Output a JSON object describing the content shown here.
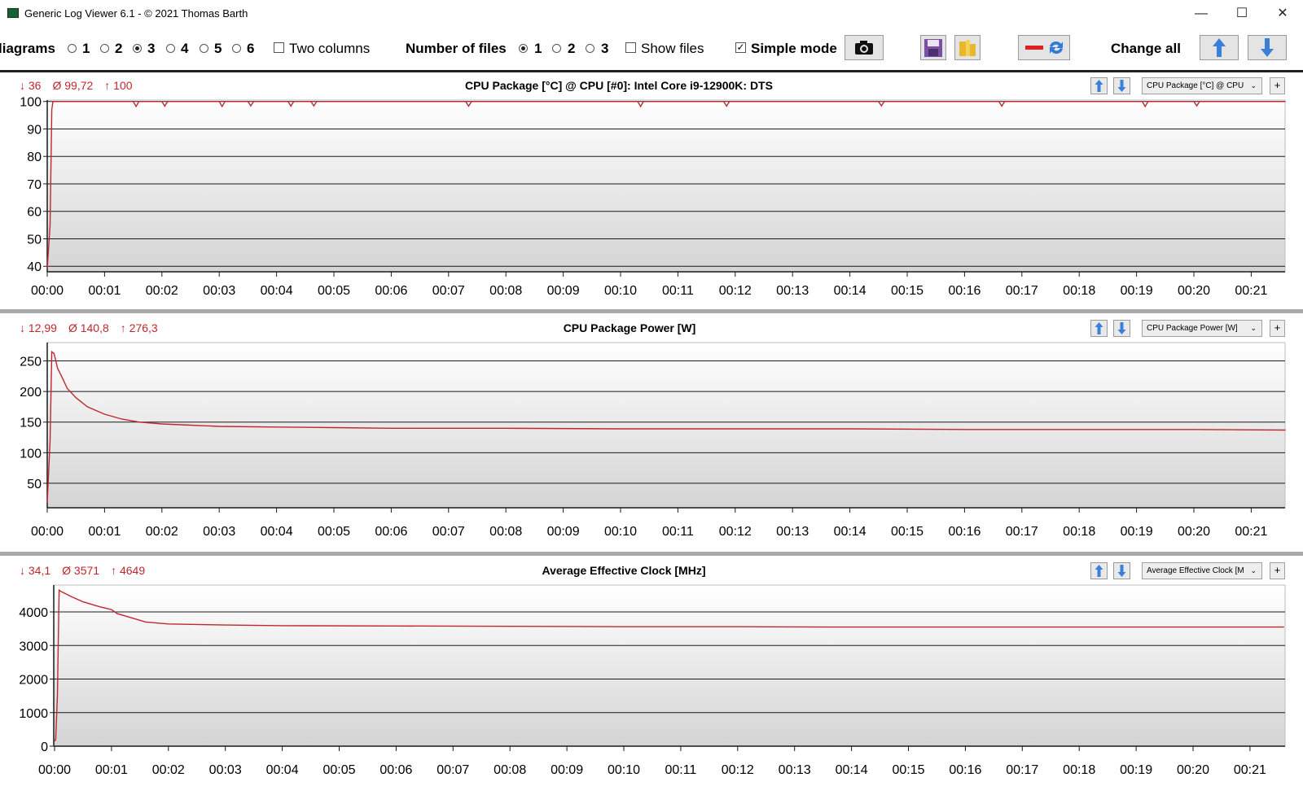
{
  "window": {
    "title": "Generic Log Viewer 6.1 - © 2021 Thomas Barth",
    "minimize": "—",
    "maximize": "☐",
    "close": "✕"
  },
  "toolbar": {
    "diagrams_label": "liagrams",
    "diagram_options": [
      "1",
      "2",
      "3",
      "4",
      "5",
      "6"
    ],
    "diagrams_selected": "3",
    "two_columns_label": "Two columns",
    "two_columns_checked": false,
    "files_label": "Number of files",
    "file_options": [
      "1",
      "2",
      "3"
    ],
    "files_selected": "1",
    "show_files_label": "Show files",
    "show_files_checked": false,
    "simple_mode_label": "Simple mode",
    "simple_mode_checked": true,
    "change_all_label": "Change all"
  },
  "colors": {
    "line": "#c0272d",
    "stats": "#c0272d",
    "arrow_blue": "#3a7fd8"
  },
  "panels": [
    {
      "stats": {
        "min": "↓ 36",
        "avg": "Ø 99,72",
        "max": "↑ 100"
      },
      "title": "CPU Package [°C] @ CPU [#0]: Intel Core i9-12900K: DTS",
      "selector": "CPU Package [°C] @ CPU",
      "plus": "+"
    },
    {
      "stats": {
        "min": "↓ 12,99",
        "avg": "Ø 140,8",
        "max": "↑ 276,3"
      },
      "title": "CPU Package Power [W]",
      "selector": "CPU Package Power [W]",
      "plus": "+"
    },
    {
      "stats": {
        "min": "↓ 34,1",
        "avg": "Ø 3571",
        "max": "↑ 4649"
      },
      "title": "Average Effective Clock [MHz]",
      "selector": "Average Effective Clock [M",
      "plus": "+"
    }
  ],
  "chart_data": [
    {
      "type": "line",
      "title": "CPU Package [°C] @ CPU [#0]: Intel Core i9-12900K: DTS",
      "xlabel": "",
      "ylabel": "",
      "x_ticks": [
        "00:00",
        "00:01",
        "00:02",
        "00:03",
        "00:04",
        "00:05",
        "00:06",
        "00:07",
        "00:08",
        "00:09",
        "00:10",
        "00:11",
        "00:12",
        "00:13",
        "00:14",
        "00:15",
        "00:16",
        "00:17",
        "00:18",
        "00:19",
        "00:20",
        "00:21"
      ],
      "y_ticks": [
        40,
        50,
        60,
        70,
        80,
        90,
        100
      ],
      "xlim_minutes": [
        0,
        21.6
      ],
      "ylim": [
        38,
        100.5
      ],
      "grid": true,
      "series": [
        {
          "color": "#c0272d",
          "x_minutes": [
            0,
            0.05,
            0.08,
            0.1,
            0.5,
            1.5,
            1.55,
            1.6,
            2.0,
            2.05,
            2.1,
            3.0,
            3.05,
            3.1,
            3.5,
            3.55,
            3.6,
            4.2,
            4.25,
            4.3,
            4.6,
            4.65,
            4.7,
            7.3,
            7.35,
            7.4,
            10.3,
            10.35,
            10.4,
            11.8,
            11.85,
            11.9,
            14.5,
            14.55,
            14.6,
            16.6,
            16.65,
            16.7,
            19.1,
            19.15,
            19.2,
            20.0,
            20.05,
            20.1,
            21.6
          ],
          "y": [
            39,
            55,
            97,
            100,
            100,
            100,
            98.2,
            100,
            100,
            98.3,
            100,
            100,
            98.2,
            100,
            100,
            98.4,
            100,
            100,
            98.3,
            100,
            100,
            98.4,
            100,
            100,
            98.3,
            100,
            100,
            98.2,
            100,
            100,
            98.3,
            100,
            100,
            98.4,
            100,
            100,
            98.3,
            100,
            100,
            98.2,
            100,
            100,
            98.4,
            100,
            100
          ]
        }
      ]
    },
    {
      "type": "line",
      "title": "CPU Package Power [W]",
      "xlabel": "",
      "ylabel": "",
      "x_ticks": [
        "00:00",
        "00:01",
        "00:02",
        "00:03",
        "00:04",
        "00:05",
        "00:06",
        "00:07",
        "00:08",
        "00:09",
        "00:10",
        "00:11",
        "00:12",
        "00:13",
        "00:14",
        "00:15",
        "00:16",
        "00:17",
        "00:18",
        "00:19",
        "00:20",
        "00:21"
      ],
      "y_ticks": [
        50,
        100,
        150,
        200,
        250
      ],
      "xlim_minutes": [
        0,
        21.6
      ],
      "ylim": [
        10,
        280
      ],
      "grid": true,
      "series": [
        {
          "color": "#c0272d",
          "x_minutes": [
            0,
            0.05,
            0.08,
            0.12,
            0.18,
            0.25,
            0.35,
            0.5,
            0.7,
            1.0,
            1.3,
            1.6,
            2.0,
            2.5,
            3.0,
            4.0,
            5.0,
            6.0,
            8.0,
            10.0,
            12.0,
            14.0,
            16.0,
            18.0,
            20.0,
            21.6
          ],
          "y": [
            18,
            120,
            265,
            262,
            238,
            225,
            205,
            190,
            175,
            163,
            155,
            150,
            147,
            145,
            143,
            142,
            141,
            140,
            140,
            139,
            139,
            139,
            138,
            138,
            138,
            137
          ]
        }
      ]
    },
    {
      "type": "line",
      "title": "Average Effective Clock [MHz]",
      "xlabel": "",
      "ylabel": "",
      "x_ticks": [
        "00:00",
        "00:01",
        "00:02",
        "00:03",
        "00:04",
        "00:05",
        "00:06",
        "00:07",
        "00:08",
        "00:09",
        "00:10",
        "00:11",
        "00:12",
        "00:13",
        "00:14",
        "00:15",
        "00:16",
        "00:17",
        "00:18",
        "00:19",
        "00:20",
        "00:21"
      ],
      "y_ticks": [
        0,
        1000,
        2000,
        3000,
        4000
      ],
      "xlim_minutes": [
        0,
        21.6
      ],
      "ylim": [
        0,
        4800
      ],
      "grid": true,
      "series": [
        {
          "color": "#c0272d",
          "x_minutes": [
            0,
            0.02,
            0.05,
            0.08,
            0.1,
            0.3,
            0.5,
            0.8,
            1.0,
            1.1,
            1.3,
            1.6,
            2.0,
            3.0,
            4.0,
            6.0,
            8.0,
            10.0,
            12.0,
            14.0,
            16.0,
            18.0,
            20.0,
            21.6
          ],
          "y": [
            150,
            200,
            1500,
            4650,
            4620,
            4450,
            4300,
            4150,
            4070,
            3950,
            3850,
            3700,
            3640,
            3610,
            3590,
            3580,
            3570,
            3560,
            3560,
            3550,
            3550,
            3550,
            3550,
            3550
          ]
        }
      ]
    }
  ]
}
